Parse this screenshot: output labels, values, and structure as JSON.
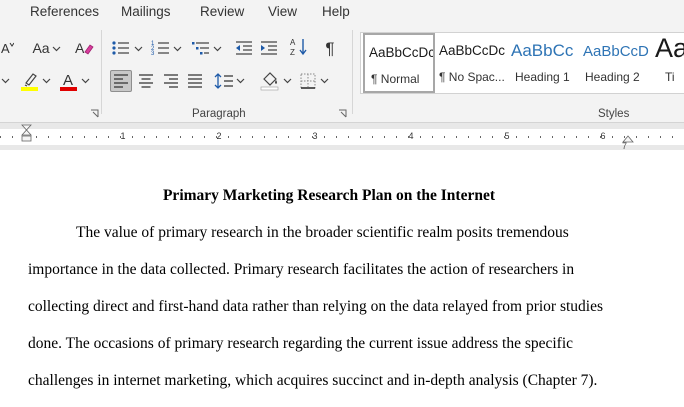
{
  "menu": [
    "References",
    "Mailings",
    "Review",
    "View",
    "Help"
  ],
  "ribbon": {
    "font_group": {
      "change_case_label": "Aa"
    },
    "paragraph_group": {
      "label": "Paragraph"
    },
    "styles_group": {
      "label": "Styles",
      "items": [
        {
          "preview": "AaBbCcDc",
          "name": "¶ Normal"
        },
        {
          "preview": "AaBbCcDc",
          "name": "¶ No Spac..."
        },
        {
          "preview": "AaBbCc",
          "name": "Heading 1"
        },
        {
          "preview": "AaBbCcD",
          "name": "Heading 2"
        },
        {
          "preview": "Aa",
          "name": "Ti"
        }
      ]
    },
    "colors": {
      "highlight": "#ffff00",
      "font_color": "#e00000",
      "heading_blue": "#2e74b5"
    }
  },
  "ruler": {
    "numbers": [
      "1",
      "2",
      "3",
      "4",
      "5",
      "6"
    ],
    "right_marker": "7"
  },
  "document": {
    "title": "Primary Marketing Research Plan on the Internet",
    "lines": [
      "The value of primary research in the broader scientific realm posits tremendous",
      "importance in the data collected. Primary research facilitates the action of researchers in",
      "collecting direct and first-hand data rather than relying on the data relayed from prior studies",
      "done. The occasions of primary research regarding the current issue address the specific",
      "challenges in internet marketing, which acquires succinct and in-depth analysis (Chapter 7)."
    ]
  }
}
